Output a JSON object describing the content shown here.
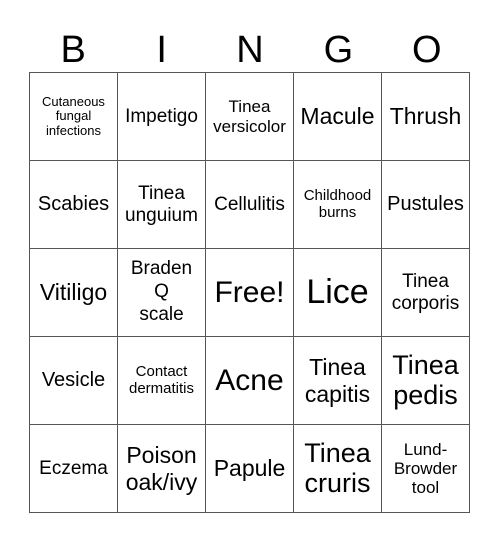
{
  "header": {
    "letters": [
      "B",
      "I",
      "N",
      "G",
      "O"
    ]
  },
  "cells": [
    "Cutaneous fungal infections",
    "Impetigo",
    "Tinea versicolor",
    "Macule",
    "Thrush",
    "Scabies",
    "Tinea unguium",
    "Cellulitis",
    "Childhood burns",
    "Pustules",
    "Vitiligo",
    "Braden Q scale",
    "Free!",
    "Lice",
    "Tinea corporis",
    "Vesicle",
    "Contact dermatitis",
    "Acne",
    "Tinea capitis",
    "Tinea pedis",
    "Eczema",
    "Poison oak/ivy",
    "Papule",
    "Tinea cruris",
    "Lund-Browder tool"
  ]
}
